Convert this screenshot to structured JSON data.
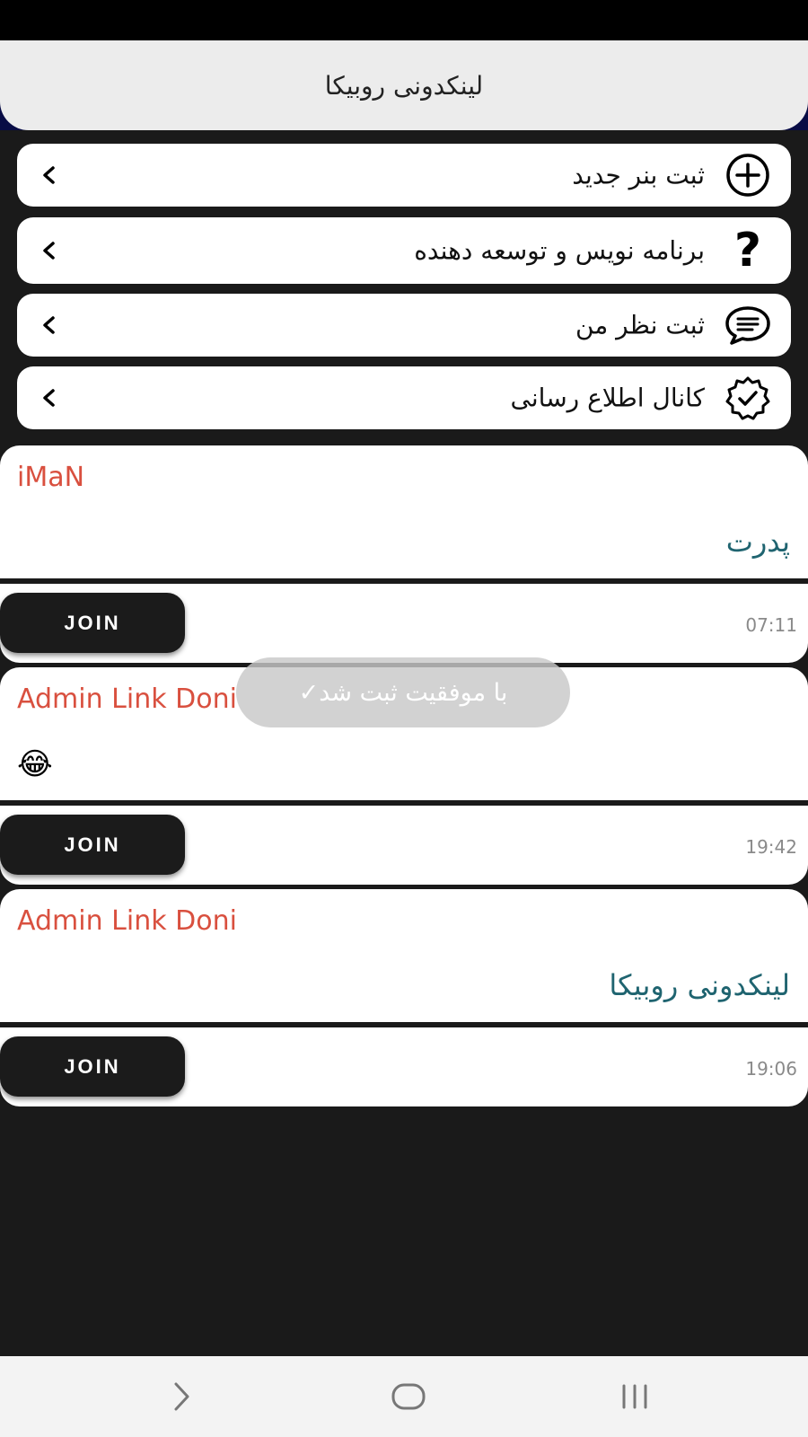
{
  "header": {
    "title": "لینکدونی روبیکا"
  },
  "menu": {
    "items": [
      {
        "label": "ثبت بنر جدید",
        "icon": "add-circle-icon"
      },
      {
        "label": "برنامه نویس و توسعه دهنده",
        "icon": "question-mark-icon"
      },
      {
        "label": "ثبت نظر من",
        "icon": "chat-bubble-icon"
      },
      {
        "label": "کانال اطلاع رسانی",
        "icon": "verified-badge-icon"
      }
    ]
  },
  "messages": [
    {
      "author": "iMaN",
      "text": "پدرت",
      "time": "07:11",
      "join_label": "JOIN"
    },
    {
      "author": "Admin Link Doni",
      "text": "😂",
      "time": "19:42",
      "join_label": "JOIN"
    },
    {
      "author": "Admin Link Doni",
      "text": "لینکدونی روبیکا",
      "time": "19:06",
      "join_label": "JOIN"
    }
  ],
  "toast": {
    "text": "با موفقیت ثبت شد✓"
  },
  "nav": {
    "icons": [
      "back-chevron-icon",
      "home-icon",
      "recents-icon"
    ]
  },
  "colors": {
    "background": "#1a1a1a",
    "header_bg": "#ececec",
    "author": "#d9503f",
    "message_text": "#1f6470",
    "join_button": "#1b1b1b"
  }
}
